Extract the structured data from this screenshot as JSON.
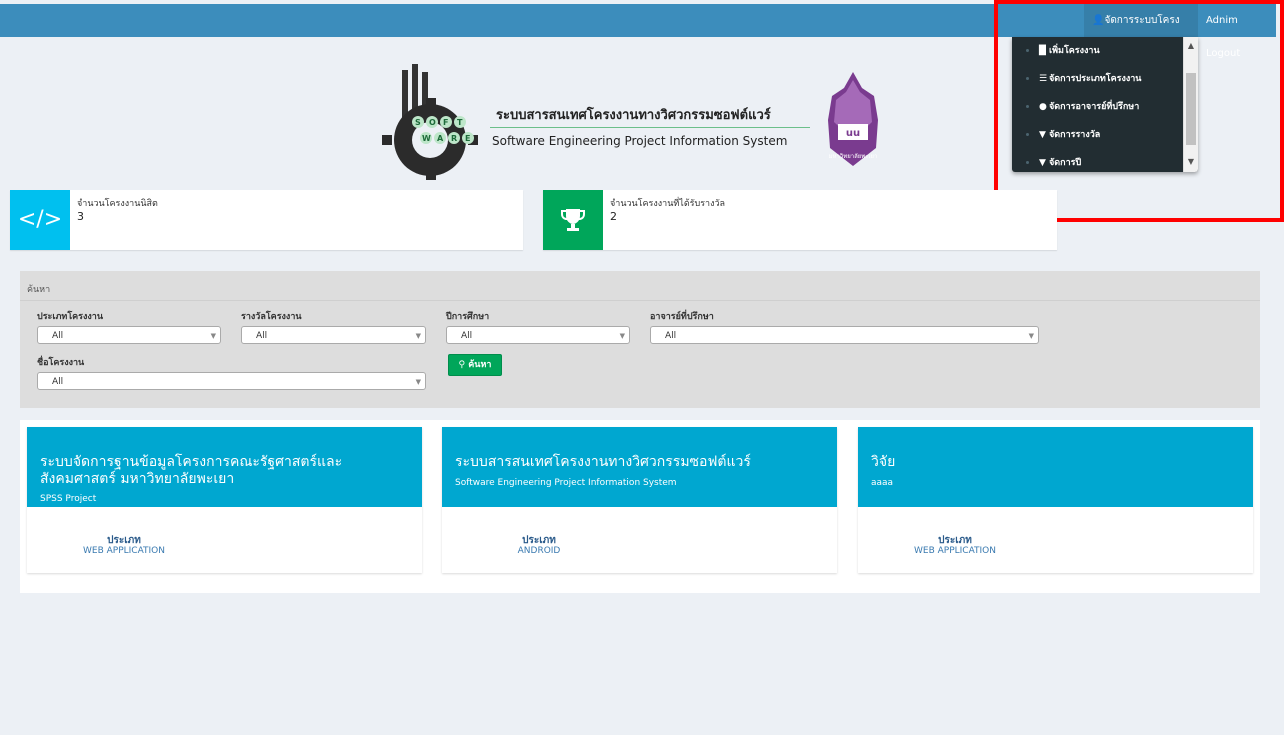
{
  "topbar": {
    "manage_label": "จัดการระบบโครงงาน",
    "logout_label": "Adnim Logout"
  },
  "dropdown": {
    "items": [
      {
        "label": "เพิ่มโครงงาน",
        "icon": "book-icon"
      },
      {
        "label": "จัดการประเภทโครงงาน",
        "icon": "list-icon"
      },
      {
        "label": "จัดการอาจารย์ที่ปรึกษา",
        "icon": "users-icon"
      },
      {
        "label": "จัดการรางวัล",
        "icon": "trophy-icon"
      },
      {
        "label": "จัดการปี",
        "icon": "trophy-icon"
      }
    ]
  },
  "logo": {
    "title_th": "ระบบสารสนเทศโครงงานทางวิศวกรรมซอฟต์แวร์",
    "title_en": "Software Engineering Project Information System",
    "gear_letters": [
      "S",
      "O",
      "F",
      "T",
      "W",
      "A",
      "R",
      "E"
    ],
    "seal_text": "มหาวิทยาลัยพะเยา"
  },
  "stats": [
    {
      "label": "จำนวนโครงงานนิสิต",
      "value": "3",
      "icon": "code-icon",
      "color": "#00c0ef"
    },
    {
      "label": "จำนวนโครงงานที่ได้รับรางวัล",
      "value": "2",
      "icon": "trophy-icon",
      "color": "#00a65a"
    }
  ],
  "search": {
    "heading": "ค้นหา",
    "project_type_label": "ประเภทโครงงาน",
    "project_type_value": "All",
    "award_label": "รางวัลโครงงาน",
    "award_value": "All",
    "year_label": "ปีการศึกษา",
    "year_value": "All",
    "advisor_label": "อาจารย์ที่ปรึกษา",
    "advisor_value": "All",
    "name_label": "ชื่อโครงงาน",
    "name_value": "All",
    "button_label": "ค้นหา"
  },
  "projects": [
    {
      "title": "ระบบจัดการฐานข้อมูลโครงการคณะรัฐศาสตร์และสังคมศาสตร์ มหาวิทยาลัยพะเยา",
      "subtitle": "SPSS Project",
      "type_label": "ประเภท",
      "type_value": "WEB APPLICATION"
    },
    {
      "title": "ระบบสารสนเทศโครงงานทางวิศวกรรมซอฟต์แวร์",
      "subtitle": "Software Engineering Project Information System",
      "type_label": "ประเภท",
      "type_value": "ANDROID"
    },
    {
      "title": "วิจัย",
      "subtitle": "aaaa",
      "type_label": "ประเภท",
      "type_value": "WEB APPLICATION"
    }
  ],
  "colors": {
    "topbar": "#3c8dbc",
    "dropdown_bg": "#222d32",
    "highlight": "#ff0000",
    "card_head": "#00a7d0",
    "button_green": "#00a65a"
  }
}
